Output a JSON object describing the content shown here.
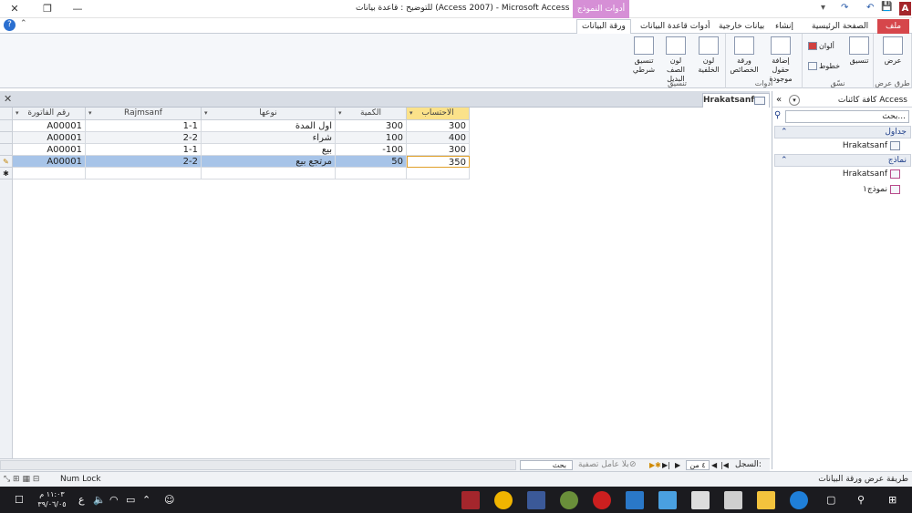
{
  "titlebar": {
    "title": "للتوضيح : قاعدة بيانات (Access 2007) - Microsoft Access",
    "contextual_header": "أدوات النموذج",
    "app_letter": "A",
    "qat": [
      "💾",
      "↶",
      "↷",
      "▾"
    ],
    "window_controls": [
      "✕",
      "❐",
      "—"
    ]
  },
  "tabs": {
    "file": "ملف",
    "items": [
      "الصفحة الرئيسية",
      "إنشاء",
      "بيانات خارجية",
      "أدوات قاعدة البيانات",
      "ورقة البيانات"
    ],
    "help": "?",
    "collapse": "⌃"
  },
  "ribbon": {
    "groups": [
      {
        "label": "طرق عرض",
        "buttons": [
          "عرض"
        ]
      },
      {
        "label": "نسّق",
        "buttons": [
          "تنسيق",
          "ألوان",
          "خطوط"
        ]
      },
      {
        "label": "أدوات",
        "buttons": [
          "إضافة حقول موجودة",
          "ورقة الخصائص"
        ]
      },
      {
        "label": "تنسيق",
        "buttons": [
          "لون الخلفية",
          "لون الصف البديل",
          "تنسيق شرطي"
        ]
      }
    ]
  },
  "nav": {
    "header": "كافة كائنات Access",
    "search_placeholder": "بحث...",
    "sections": [
      {
        "title": "جداول",
        "items": [
          "Hrakatsanf"
        ]
      },
      {
        "title": "نماذج",
        "items": [
          "Hrakatsanf",
          "نموذج١"
        ]
      }
    ]
  },
  "doc": {
    "tab": "Hrakatsanf",
    "close": "✕"
  },
  "grid": {
    "columns": [
      "رقم الفاتورة",
      "Rajmsanf",
      "نوعها",
      "الكمية",
      "الاحتساب"
    ],
    "rows": [
      {
        "selector": "",
        "values": [
          "A00001",
          "1-1",
          "اول المدة",
          "300",
          "300"
        ]
      },
      {
        "selector": "",
        "values": [
          "A00001",
          "2-2",
          "شراء",
          "100",
          "400"
        ]
      },
      {
        "selector": "",
        "values": [
          "A00001",
          "1-1",
          "بيع",
          "-100",
          "300"
        ]
      },
      {
        "selector": "✎",
        "values": [
          "A00001",
          "2-2",
          "مرتجع بيع",
          "50",
          "350"
        ]
      }
    ],
    "new_row_marker": "✱"
  },
  "record_nav": {
    "label": "السجل:",
    "position": "٤ من ٤",
    "filter": "بلا عامل تصفية",
    "search": "بحث"
  },
  "status": {
    "left": "طريقة عرض ورقة البيانات",
    "numlock": "Num Lock"
  },
  "taskbar": {
    "time": "١١:٠٣ م",
    "date": "٣٩/٠٦/٠٥",
    "lang": "ع"
  },
  "colors": {
    "accent_red": "#d6464b",
    "contextual": "#d68fd6",
    "selection": "#a7c4e8"
  }
}
